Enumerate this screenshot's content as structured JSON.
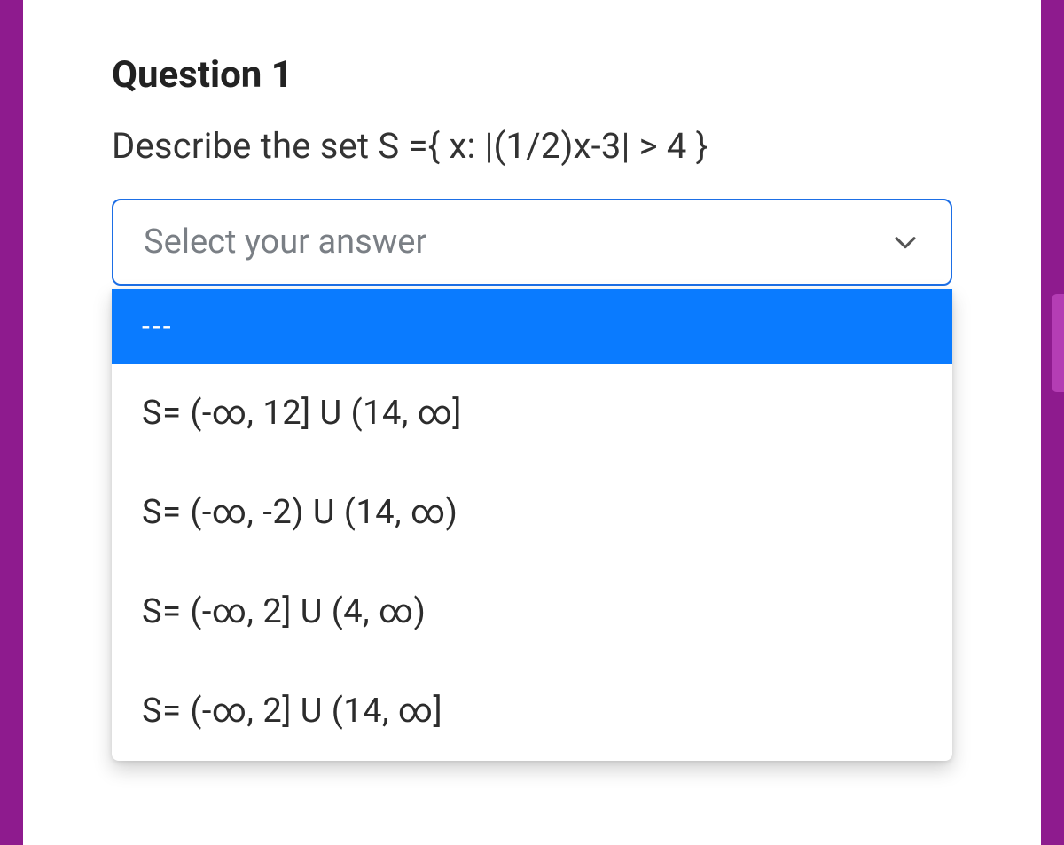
{
  "question": {
    "title": "Question 1",
    "prompt": "Describe the set S ={ x: |(1/2)x-3| > 4 }"
  },
  "select": {
    "placeholder": "Select your answer"
  },
  "options": {
    "highlighted": "---",
    "opt1": "S=  (-∞,  12] U  (14,  ∞]",
    "opt2": "S=  (-∞,  -2) U  (14,  ∞)",
    "opt3": "S=  (-∞,  2] U  (4,  ∞)",
    "opt4": "S=  (-∞,  2] U  (14,  ∞]"
  }
}
